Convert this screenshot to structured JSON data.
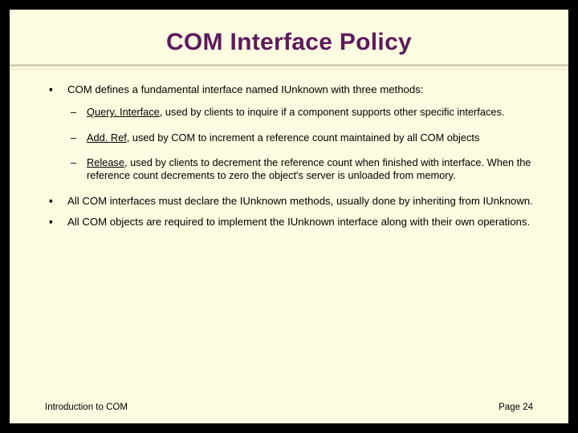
{
  "title": "COM Interface Policy",
  "bullets": [
    {
      "text": "COM defines a fundamental interface named IUnknown with three methods:",
      "sub": [
        {
          "name": "Query. Interface",
          "rest": ", used by clients to inquire if a component supports other specific interfaces."
        },
        {
          "name": "Add. Ref",
          "rest": ", used by COM to increment a reference count maintained by all COM objects"
        },
        {
          "name": "Release",
          "rest": ", used by clients to decrement the reference count when finished with interface.  When the reference count decrements to zero the object's server is unloaded from memory."
        }
      ]
    },
    {
      "text": "All COM interfaces must declare the IUnknown methods, usually done by inheriting from IUnknown."
    },
    {
      "text": "All COM objects are required to implement the IUnknown interface along with their own operations."
    }
  ],
  "footer": {
    "left": "Introduction to COM",
    "right": "Page 24"
  }
}
